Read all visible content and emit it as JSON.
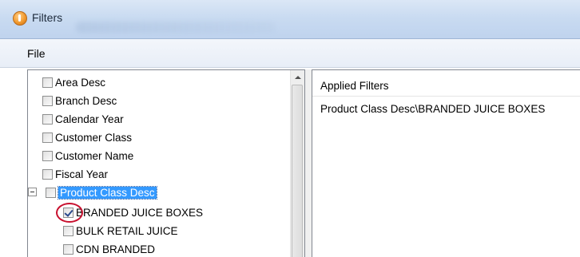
{
  "window": {
    "title": "Filters"
  },
  "menu": {
    "file_label": "File"
  },
  "tree": {
    "fields": [
      {
        "label": "Area Desc",
        "checked": false
      },
      {
        "label": "Branch Desc",
        "checked": false
      },
      {
        "label": "Calendar Year",
        "checked": false
      },
      {
        "label": "Customer Class",
        "checked": false
      },
      {
        "label": "Customer Name",
        "checked": false
      },
      {
        "label": "Fiscal Year",
        "checked": false
      }
    ],
    "expanded_field": {
      "label": "Product Class Desc",
      "checked": false,
      "children": [
        {
          "label": "BRANDED JUICE BOXES",
          "checked": true
        },
        {
          "label": "BULK RETAIL JUICE",
          "checked": false
        },
        {
          "label": "CDN BRANDED",
          "checked": false
        }
      ]
    }
  },
  "applied": {
    "header": "Applied Filters",
    "items": [
      "Product Class Desc\\BRANDED JUICE BOXES"
    ]
  },
  "colors": {
    "selection": "#3399ff",
    "highlight_ring": "#c8102e"
  }
}
